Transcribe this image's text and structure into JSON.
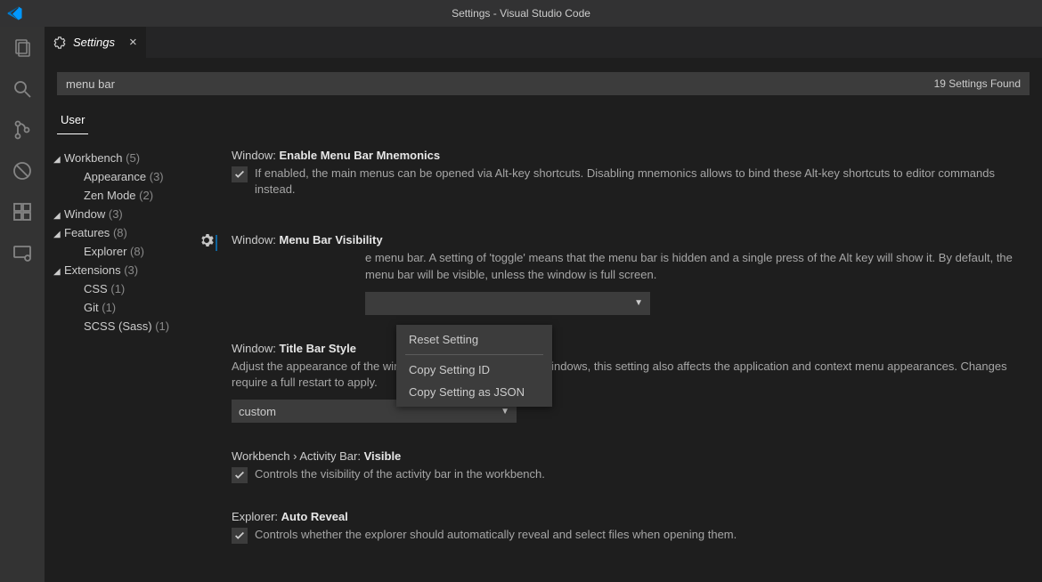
{
  "titlebar": {
    "title": "Settings - Visual Studio Code"
  },
  "tab": {
    "label": "Settings"
  },
  "search": {
    "value": "menu bar",
    "count_label": "19 Settings Found"
  },
  "scope": {
    "user": "User"
  },
  "toc": {
    "items": [
      {
        "label": "Workbench",
        "count": "(5)",
        "expandable": true
      },
      {
        "label": "Appearance",
        "count": "(3)",
        "child": true
      },
      {
        "label": "Zen Mode",
        "count": "(2)",
        "child": true
      },
      {
        "label": "Window",
        "count": "(3)",
        "expandable": true
      },
      {
        "label": "Features",
        "count": "(8)",
        "expandable": true
      },
      {
        "label": "Explorer",
        "count": "(8)",
        "child": true
      },
      {
        "label": "Extensions",
        "count": "(3)",
        "expandable": true
      },
      {
        "label": "CSS",
        "count": "(1)",
        "child": true
      },
      {
        "label": "Git",
        "count": "(1)",
        "child": true
      },
      {
        "label": "SCSS (Sass)",
        "count": "(1)",
        "child": true
      }
    ]
  },
  "settings": {
    "s1": {
      "cat": "Window:",
      "name": "Enable Menu Bar Mnemonics",
      "desc": "If enabled, the main menus can be opened via Alt-key shortcuts. Disabling mnemonics allows to bind these Alt-key shortcuts to editor commands instead."
    },
    "s2": {
      "cat": "Window:",
      "name": "Menu Bar Visibility",
      "desc": "e menu bar. A setting of 'toggle' means that the menu bar is hidden and a single press of the Alt key will show it. By default, the menu bar will be visible, unless the window is full screen.",
      "value": ""
    },
    "s3": {
      "cat": "Window:",
      "name": "Title Bar Style",
      "desc": "Adjust the appearance of the window title bar. On Linux and Windows, this setting also affects the application and context menu appearances. Changes require a full restart to apply.",
      "value": "custom"
    },
    "s4": {
      "cat": "Workbench › Activity Bar:",
      "name": "Visible",
      "desc": "Controls the visibility of the activity bar in the workbench."
    },
    "s5": {
      "cat": "Explorer:",
      "name": "Auto Reveal",
      "desc": "Controls whether the explorer should automatically reveal and select files when opening them."
    }
  },
  "context_menu": {
    "reset": "Reset Setting",
    "copy_id": "Copy Setting ID",
    "copy_json": "Copy Setting as JSON"
  }
}
